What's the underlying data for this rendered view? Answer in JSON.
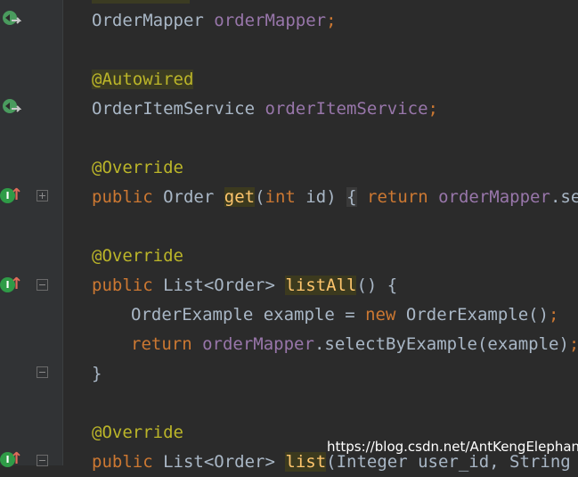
{
  "editor": {
    "lines": {
      "l1": {
        "type": "OrderMapper",
        "field": "orderMapper",
        "semi": ";"
      },
      "l2": {
        "annotation": "@Autowired"
      },
      "l3": {
        "type": "OrderItemService",
        "field": "orderItemService",
        "semi": ";"
      },
      "l4": {
        "annotation": "@Override"
      },
      "l5": {
        "kw_public": "public",
        "type": "Order",
        "method": "get",
        "paren_open": "(",
        "kw_int": "int",
        "param": " id",
        "paren_close": ")",
        "brace": "{",
        "kw_return": "return",
        "field": "orderMapper",
        "rest": ".sele"
      },
      "l6": {
        "annotation": "@Override"
      },
      "l7": {
        "kw_public": "public",
        "type": "List<Order>",
        "method": "listAll",
        "rest": "() {"
      },
      "l8": {
        "type": "OrderExample example = ",
        "kw_new": "new",
        "rest": " OrderExample()",
        "semi": ";"
      },
      "l9": {
        "kw_return": "return",
        "field": "orderMapper",
        "rest": ".selectByExample(example)",
        "semi": ";"
      },
      "l10": {
        "brace": "}"
      },
      "l11": {
        "annotation": "@Override"
      },
      "l12": {
        "kw_public": "public",
        "type": "List<Order>",
        "method": "list",
        "rest": "(Integer user_id, String ex"
      }
    }
  },
  "gutter": {
    "impl_letter": "I",
    "icons": [
      "autowire-icon",
      "implements-icon",
      "fold-icon"
    ]
  },
  "watermark": {
    "text": "https://blog.csdn.net/AntKengElephant"
  },
  "colors": {
    "background": "#2b2b2b",
    "gutter": "#313335",
    "keyword": "#cc7832",
    "annotation": "#bbb529",
    "field": "#9876aa",
    "method": "#ffc66d",
    "text": "#a9b7c6"
  }
}
